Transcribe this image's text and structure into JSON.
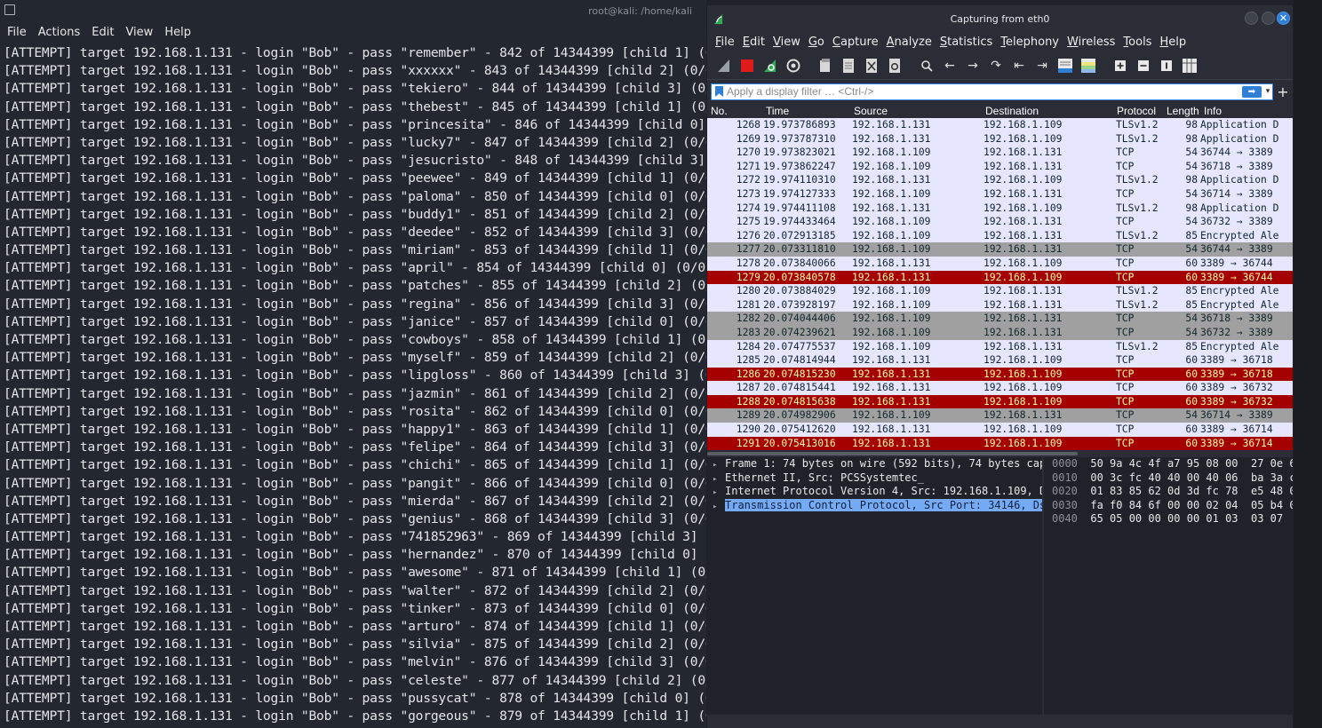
{
  "terminal": {
    "window_title": "root@kali: /home/kali",
    "menu": [
      "File",
      "Actions",
      "Edit",
      "View",
      "Help"
    ],
    "lines": [
      "[ATTEMPT] target 192.168.1.131 - login \"Bob\" - pass \"remember\" - 842 of 14344399 [child 1] (0/0)",
      "[ATTEMPT] target 192.168.1.131 - login \"Bob\" - pass \"xxxxxx\" - 843 of 14344399 [child 2] (0/0)",
      "[ATTEMPT] target 192.168.1.131 - login \"Bob\" - pass \"tekiero\" - 844 of 14344399 [child 3] (0/0)",
      "[ATTEMPT] target 192.168.1.131 - login \"Bob\" - pass \"thebest\" - 845 of 14344399 [child 1] (0/0)",
      "[ATTEMPT] target 192.168.1.131 - login \"Bob\" - pass \"princesita\" - 846 of 14344399 [child 0] (0/0)",
      "[ATTEMPT] target 192.168.1.131 - login \"Bob\" - pass \"lucky7\" - 847 of 14344399 [child 2] (0/0)",
      "[ATTEMPT] target 192.168.1.131 - login \"Bob\" - pass \"jesucristo\" - 848 of 14344399 [child 3] (0/0)",
      "[ATTEMPT] target 192.168.1.131 - login \"Bob\" - pass \"peewee\" - 849 of 14344399 [child 1] (0/0)",
      "[ATTEMPT] target 192.168.1.131 - login \"Bob\" - pass \"paloma\" - 850 of 14344399 [child 0] (0/0)",
      "[ATTEMPT] target 192.168.1.131 - login \"Bob\" - pass \"buddy1\" - 851 of 14344399 [child 2] (0/0)",
      "[ATTEMPT] target 192.168.1.131 - login \"Bob\" - pass \"deedee\" - 852 of 14344399 [child 3] (0/0)",
      "[ATTEMPT] target 192.168.1.131 - login \"Bob\" - pass \"miriam\" - 853 of 14344399 [child 1] (0/0)",
      "[ATTEMPT] target 192.168.1.131 - login \"Bob\" - pass \"april\" - 854 of 14344399 [child 0] (0/0)",
      "[ATTEMPT] target 192.168.1.131 - login \"Bob\" - pass \"patches\" - 855 of 14344399 [child 2] (0/0)",
      "[ATTEMPT] target 192.168.1.131 - login \"Bob\" - pass \"regina\" - 856 of 14344399 [child 3] (0/0)",
      "[ATTEMPT] target 192.168.1.131 - login \"Bob\" - pass \"janice\" - 857 of 14344399 [child 0] (0/0)",
      "[ATTEMPT] target 192.168.1.131 - login \"Bob\" - pass \"cowboys\" - 858 of 14344399 [child 1] (0/0)",
      "[ATTEMPT] target 192.168.1.131 - login \"Bob\" - pass \"myself\" - 859 of 14344399 [child 2] (0/0)",
      "[ATTEMPT] target 192.168.1.131 - login \"Bob\" - pass \"lipgloss\" - 860 of 14344399 [child 3] (0/0)",
      "[ATTEMPT] target 192.168.1.131 - login \"Bob\" - pass \"jazmin\" - 861 of 14344399 [child 2] (0/0)",
      "[ATTEMPT] target 192.168.1.131 - login \"Bob\" - pass \"rosita\" - 862 of 14344399 [child 0] (0/0)",
      "[ATTEMPT] target 192.168.1.131 - login \"Bob\" - pass \"happy1\" - 863 of 14344399 [child 1] (0/0)",
      "[ATTEMPT] target 192.168.1.131 - login \"Bob\" - pass \"felipe\" - 864 of 14344399 [child 3] (0/0)",
      "[ATTEMPT] target 192.168.1.131 - login \"Bob\" - pass \"chichi\" - 865 of 14344399 [child 1] (0/0)",
      "[ATTEMPT] target 192.168.1.131 - login \"Bob\" - pass \"pangit\" - 866 of 14344399 [child 0] (0/0)",
      "[ATTEMPT] target 192.168.1.131 - login \"Bob\" - pass \"mierda\" - 867 of 14344399 [child 2] (0/0)",
      "[ATTEMPT] target 192.168.1.131 - login \"Bob\" - pass \"genius\" - 868 of 14344399 [child 3] (0/0)",
      "[ATTEMPT] target 192.168.1.131 - login \"Bob\" - pass \"741852963\" - 869 of 14344399 [child 3] (0/0)",
      "[ATTEMPT] target 192.168.1.131 - login \"Bob\" - pass \"hernandez\" - 870 of 14344399 [child 0] (0/0)",
      "[ATTEMPT] target 192.168.1.131 - login \"Bob\" - pass \"awesome\" - 871 of 14344399 [child 1] (0/0)",
      "[ATTEMPT] target 192.168.1.131 - login \"Bob\" - pass \"walter\" - 872 of 14344399 [child 2] (0/0)",
      "[ATTEMPT] target 192.168.1.131 - login \"Bob\" - pass \"tinker\" - 873 of 14344399 [child 0] (0/0)",
      "[ATTEMPT] target 192.168.1.131 - login \"Bob\" - pass \"arturo\" - 874 of 14344399 [child 1] (0/0)",
      "[ATTEMPT] target 192.168.1.131 - login \"Bob\" - pass \"silvia\" - 875 of 14344399 [child 2] (0/0)",
      "[ATTEMPT] target 192.168.1.131 - login \"Bob\" - pass \"melvin\" - 876 of 14344399 [child 3] (0/0)",
      "[ATTEMPT] target 192.168.1.131 - login \"Bob\" - pass \"celeste\" - 877 of 14344399 [child 2] (0/0)",
      "[ATTEMPT] target 192.168.1.131 - login \"Bob\" - pass \"pussycat\" - 878 of 14344399 [child 0] (0/0)",
      "[ATTEMPT] target 192.168.1.131 - login \"Bob\" - pass \"gorgeous\" - 879 of 14344399 [child 1] (0/0)"
    ]
  },
  "wireshark": {
    "window_title": "Capturing from eth0",
    "menu": [
      "File",
      "Edit",
      "View",
      "Go",
      "Capture",
      "Analyze",
      "Statistics",
      "Telephony",
      "Wireless",
      "Tools",
      "Help"
    ],
    "toolbar_icons": [
      "shark-fin-start-icon",
      "stop-capture-icon",
      "restart-capture-icon",
      "capture-options-icon",
      "open-file-icon",
      "save-file-icon",
      "close-file-icon",
      "reload-file-icon",
      "search-icon",
      "go-back-icon",
      "go-forward-icon",
      "go-to-packet-icon",
      "first-packet-icon",
      "last-packet-icon",
      "autoscroll-icon",
      "colorize-icon",
      "zoom-in-icon",
      "zoom-out-icon",
      "normal-size-icon",
      "resize-columns-icon"
    ],
    "filter_placeholder": "Apply a display filter … <Ctrl-/>",
    "columns": {
      "no": "No.",
      "time": "Time",
      "source": "Source",
      "destination": "Destination",
      "protocol": "Protocol",
      "length": "Length",
      "info": "Info"
    },
    "packets": [
      {
        "no": "1268",
        "time": "19.973786893",
        "src": "192.168.1.131",
        "dst": "192.168.1.109",
        "proto": "TLSv1.2",
        "len": "98",
        "info": "Application D",
        "color": "tls"
      },
      {
        "no": "1269",
        "time": "19.973787310",
        "src": "192.168.1.131",
        "dst": "192.168.1.109",
        "proto": "TLSv1.2",
        "len": "98",
        "info": "Application D",
        "color": "tls"
      },
      {
        "no": "1270",
        "time": "19.973823021",
        "src": "192.168.1.109",
        "dst": "192.168.1.131",
        "proto": "TCP",
        "len": "54",
        "info": "36744 → 3389",
        "color": "tcp"
      },
      {
        "no": "1271",
        "time": "19.973862247",
        "src": "192.168.1.109",
        "dst": "192.168.1.131",
        "proto": "TCP",
        "len": "54",
        "info": "36718 → 3389",
        "color": "tcp"
      },
      {
        "no": "1272",
        "time": "19.974110310",
        "src": "192.168.1.131",
        "dst": "192.168.1.109",
        "proto": "TLSv1.2",
        "len": "98",
        "info": "Application D",
        "color": "tls"
      },
      {
        "no": "1273",
        "time": "19.974127333",
        "src": "192.168.1.109",
        "dst": "192.168.1.131",
        "proto": "TCP",
        "len": "54",
        "info": "36714 → 3389",
        "color": "tcp"
      },
      {
        "no": "1274",
        "time": "19.974411108",
        "src": "192.168.1.131",
        "dst": "192.168.1.109",
        "proto": "TLSv1.2",
        "len": "98",
        "info": "Application D",
        "color": "tls"
      },
      {
        "no": "1275",
        "time": "19.974433464",
        "src": "192.168.1.109",
        "dst": "192.168.1.131",
        "proto": "TCP",
        "len": "54",
        "info": "36732 → 3389",
        "color": "tcp"
      },
      {
        "no": "1276",
        "time": "20.072913185",
        "src": "192.168.1.109",
        "dst": "192.168.1.131",
        "proto": "TLSv1.2",
        "len": "85",
        "info": "Encrypted Ale",
        "color": "tls"
      },
      {
        "no": "1277",
        "time": "20.073311810",
        "src": "192.168.1.109",
        "dst": "192.168.1.131",
        "proto": "TCP",
        "len": "54",
        "info": "36744 → 3389",
        "color": "gray"
      },
      {
        "no": "1278",
        "time": "20.073840066",
        "src": "192.168.1.131",
        "dst": "192.168.1.109",
        "proto": "TCP",
        "len": "60",
        "info": "3389 → 36744",
        "color": "tcp"
      },
      {
        "no": "1279",
        "time": "20.073840578",
        "src": "192.168.1.131",
        "dst": "192.168.1.109",
        "proto": "TCP",
        "len": "60",
        "info": "3389 → 36744",
        "color": "red"
      },
      {
        "no": "1280",
        "time": "20.073884029",
        "src": "192.168.1.109",
        "dst": "192.168.1.131",
        "proto": "TLSv1.2",
        "len": "85",
        "info": "Encrypted Ale",
        "color": "tls"
      },
      {
        "no": "1281",
        "time": "20.073928197",
        "src": "192.168.1.109",
        "dst": "192.168.1.131",
        "proto": "TLSv1.2",
        "len": "85",
        "info": "Encrypted Ale",
        "color": "tls"
      },
      {
        "no": "1282",
        "time": "20.074044406",
        "src": "192.168.1.109",
        "dst": "192.168.1.131",
        "proto": "TCP",
        "len": "54",
        "info": "36718 → 3389",
        "color": "gray"
      },
      {
        "no": "1283",
        "time": "20.074239621",
        "src": "192.168.1.109",
        "dst": "192.168.1.131",
        "proto": "TCP",
        "len": "54",
        "info": "36732 → 3389",
        "color": "gray"
      },
      {
        "no": "1284",
        "time": "20.074775537",
        "src": "192.168.1.109",
        "dst": "192.168.1.131",
        "proto": "TLSv1.2",
        "len": "85",
        "info": "Encrypted Ale",
        "color": "tls"
      },
      {
        "no": "1285",
        "time": "20.074814944",
        "src": "192.168.1.131",
        "dst": "192.168.1.109",
        "proto": "TCP",
        "len": "60",
        "info": "3389 → 36718",
        "color": "tcp"
      },
      {
        "no": "1286",
        "time": "20.074815230",
        "src": "192.168.1.131",
        "dst": "192.168.1.109",
        "proto": "TCP",
        "len": "60",
        "info": "3389 → 36718",
        "color": "red"
      },
      {
        "no": "1287",
        "time": "20.074815441",
        "src": "192.168.1.131",
        "dst": "192.168.1.109",
        "proto": "TCP",
        "len": "60",
        "info": "3389 → 36732",
        "color": "tcp"
      },
      {
        "no": "1288",
        "time": "20.074815638",
        "src": "192.168.1.131",
        "dst": "192.168.1.109",
        "proto": "TCP",
        "len": "60",
        "info": "3389 → 36732",
        "color": "red"
      },
      {
        "no": "1289",
        "time": "20.074982906",
        "src": "192.168.1.109",
        "dst": "192.168.1.131",
        "proto": "TCP",
        "len": "54",
        "info": "36714 → 3389",
        "color": "gray"
      },
      {
        "no": "1290",
        "time": "20.075412620",
        "src": "192.168.1.131",
        "dst": "192.168.1.109",
        "proto": "TCP",
        "len": "60",
        "info": "3389 → 36714",
        "color": "tcp"
      },
      {
        "no": "1291",
        "time": "20.075413016",
        "src": "192.168.1.131",
        "dst": "192.168.1.109",
        "proto": "TCP",
        "len": "60",
        "info": "3389 → 36714",
        "color": "red"
      }
    ],
    "details": [
      {
        "text": "Frame 1: 74 bytes on wire (592 bits), 74 bytes capt",
        "selected": false
      },
      {
        "text": "Ethernet II, Src: PCSSystemtec_",
        "selected": false
      },
      {
        "text": "Internet Protocol Version 4, Src: 192.168.1.109, Ds",
        "selected": false
      },
      {
        "text": "Transmission Control Protocol, Src Port: 34146, Dst",
        "selected": true
      }
    ],
    "hex": [
      {
        "offset": "0000",
        "bytes": "50 9a 4c 4f a7 95 08 00  27 0e 6"
      },
      {
        "offset": "0010",
        "bytes": "00 3c fc 40 40 00 40 06  ba 3a c"
      },
      {
        "offset": "0020",
        "bytes": "01 83 85 62 0d 3d fc 78  e5 48 0"
      },
      {
        "offset": "0030",
        "bytes": "fa f0 84 6f 00 00 02 04  05 b4 0"
      },
      {
        "offset": "0040",
        "bytes": "65 05 00 00 00 00 01 03  03 07"
      }
    ]
  },
  "colors": {
    "terminal_bg": "#232730",
    "tcp_row": "#e7e6ff",
    "bad_tcp_row": "#a40000",
    "bad_tcp_text": "#fffc9c",
    "gray_row": "#a0a0a0",
    "accent": "#2f7fd6"
  }
}
